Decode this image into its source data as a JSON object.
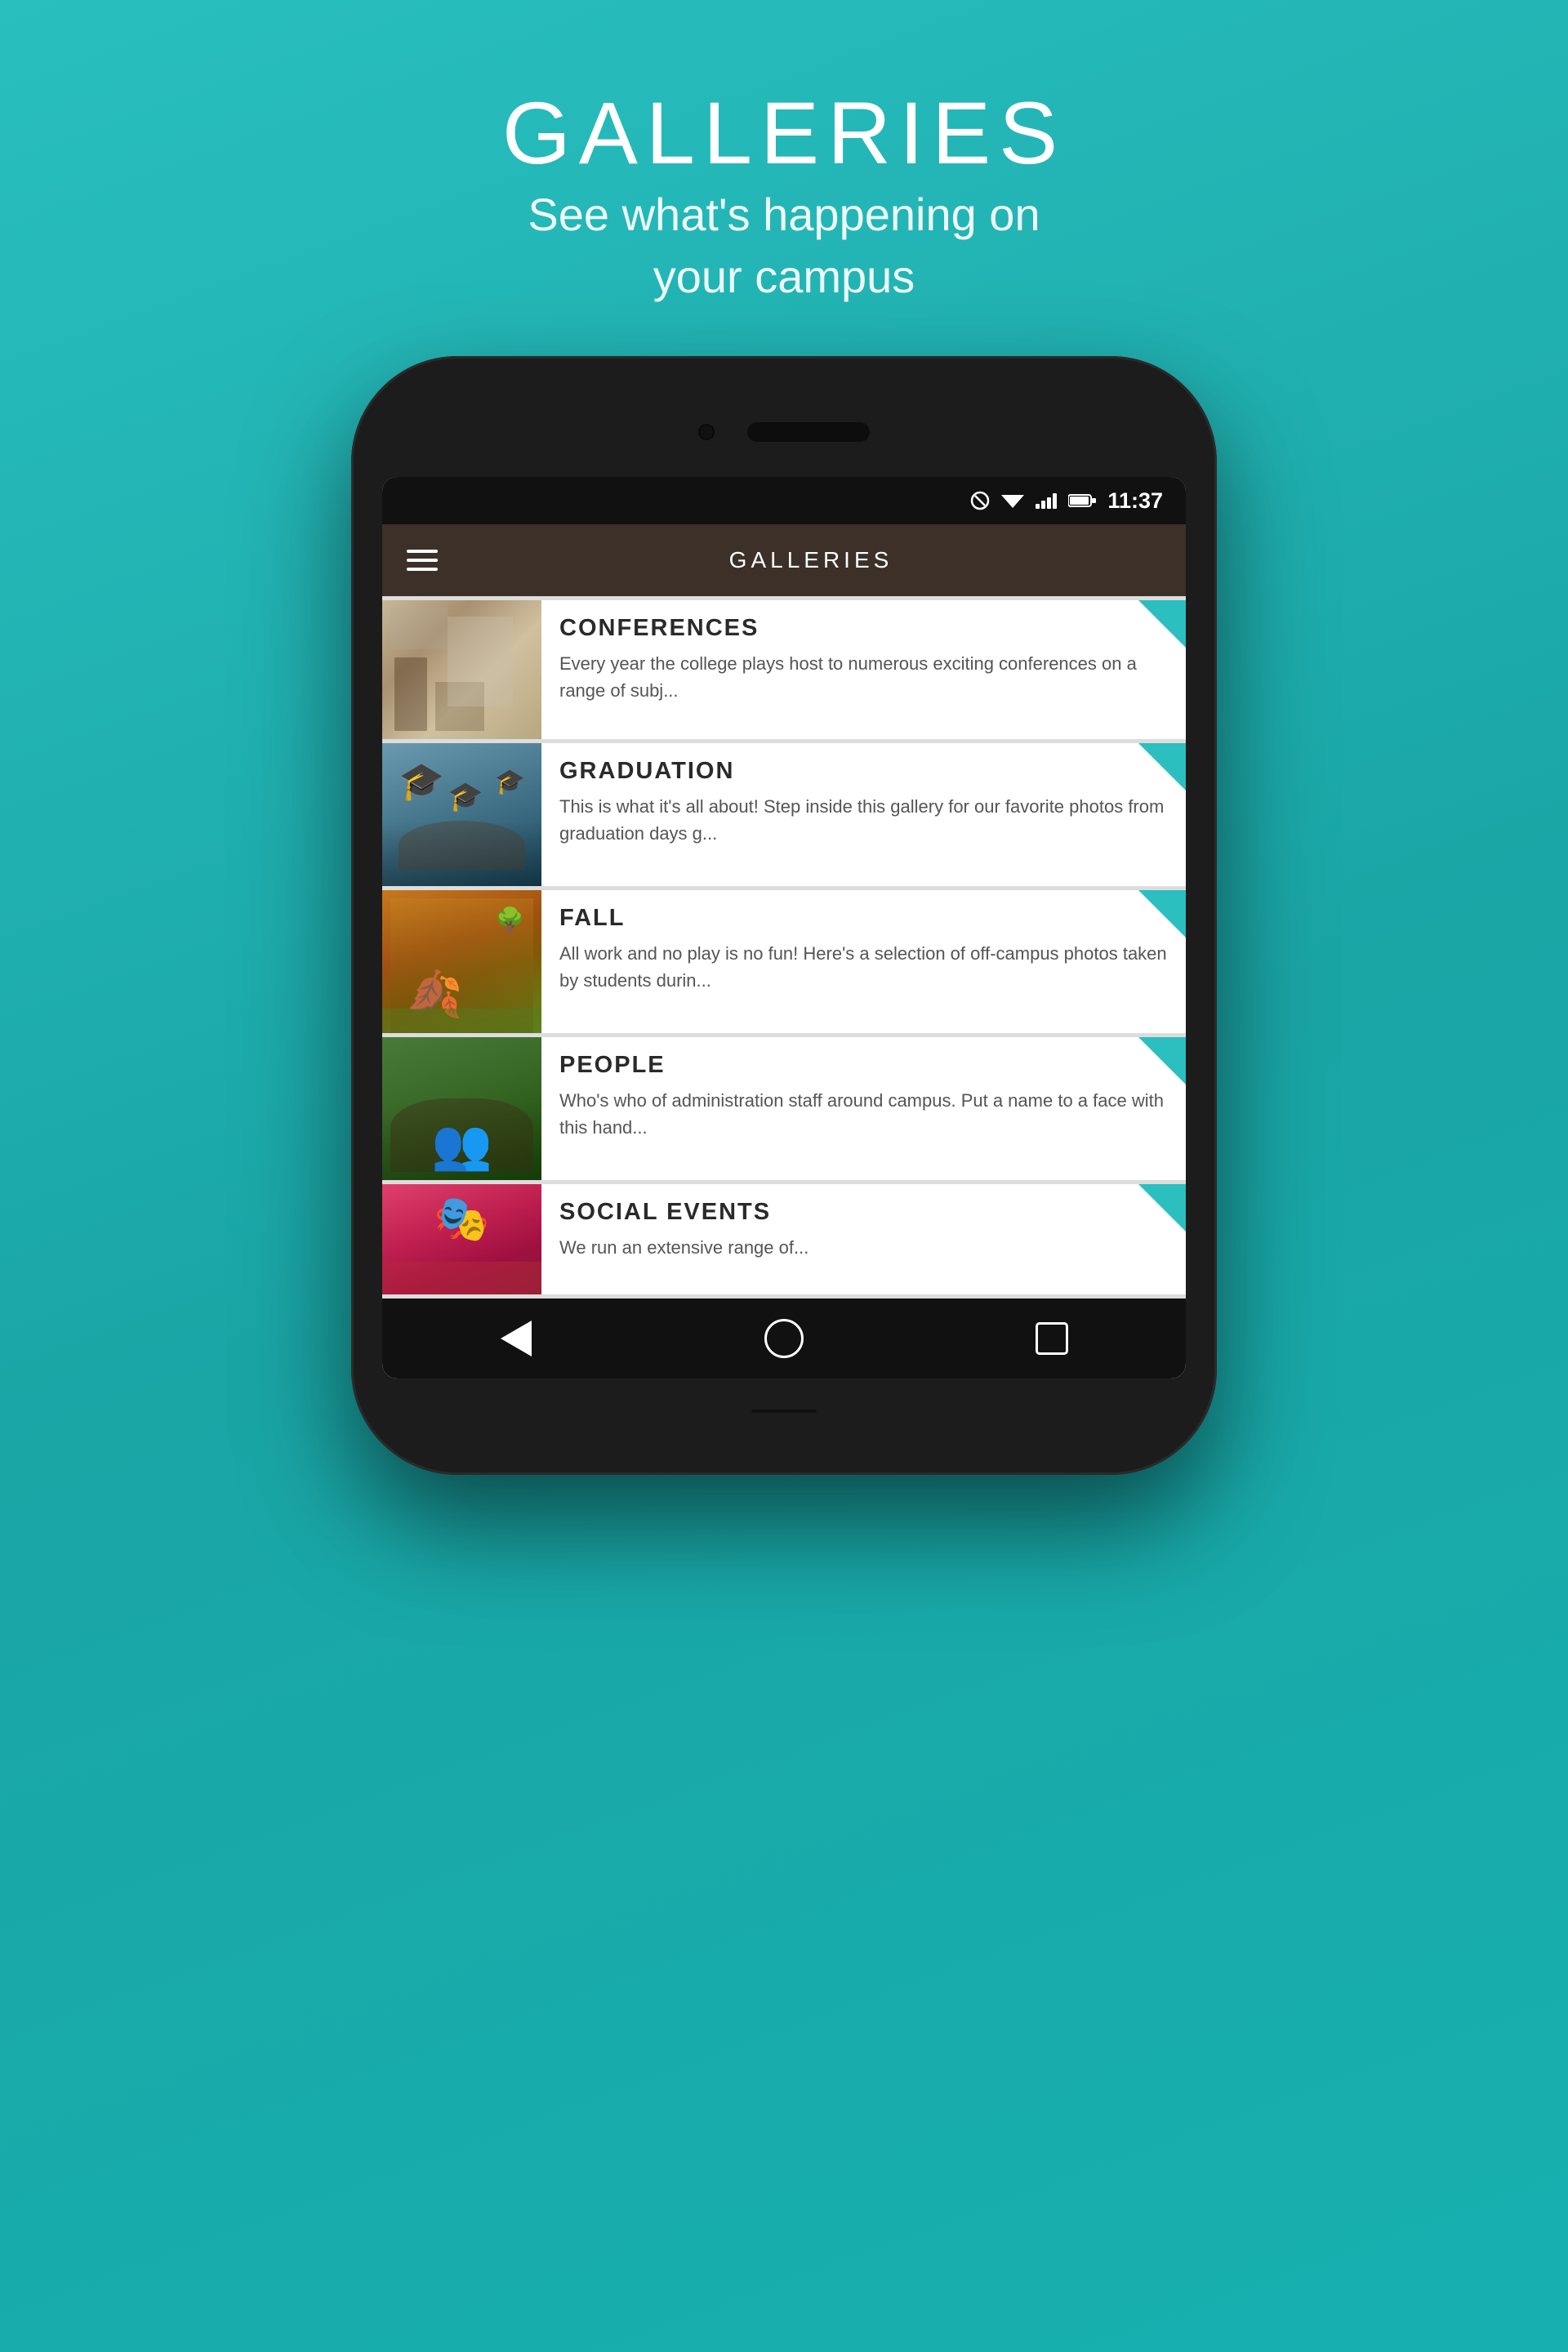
{
  "page": {
    "title": "GALLERIES",
    "subtitle": "See what's happening on\nyour campus"
  },
  "appbar": {
    "title": "GALLERIES"
  },
  "status": {
    "time": "11:37"
  },
  "gallery_items": [
    {
      "id": "conferences",
      "title": "CONFERENCES",
      "description": "Every year the college plays host to numerous exciting conferences on a range of subj...",
      "thumb_class": "thumb-conferences"
    },
    {
      "id": "graduation",
      "title": "GRADUATION",
      "description": "This is what it's all about!  Step inside this gallery for our favorite photos from graduation days g...",
      "thumb_class": "thumb-graduation"
    },
    {
      "id": "fall",
      "title": "FALL",
      "description": "All work and no play is no fun!  Here's a selection of off-campus photos taken by students durin...",
      "thumb_class": "thumb-fall"
    },
    {
      "id": "people",
      "title": "PEOPLE",
      "description": "Who's who of administration staff around campus.  Put a name to a face with this hand...",
      "thumb_class": "thumb-people"
    },
    {
      "id": "social-events",
      "title": "SOCIAL EVENTS",
      "description": "We run an extensive range of...",
      "thumb_class": "thumb-social"
    }
  ]
}
